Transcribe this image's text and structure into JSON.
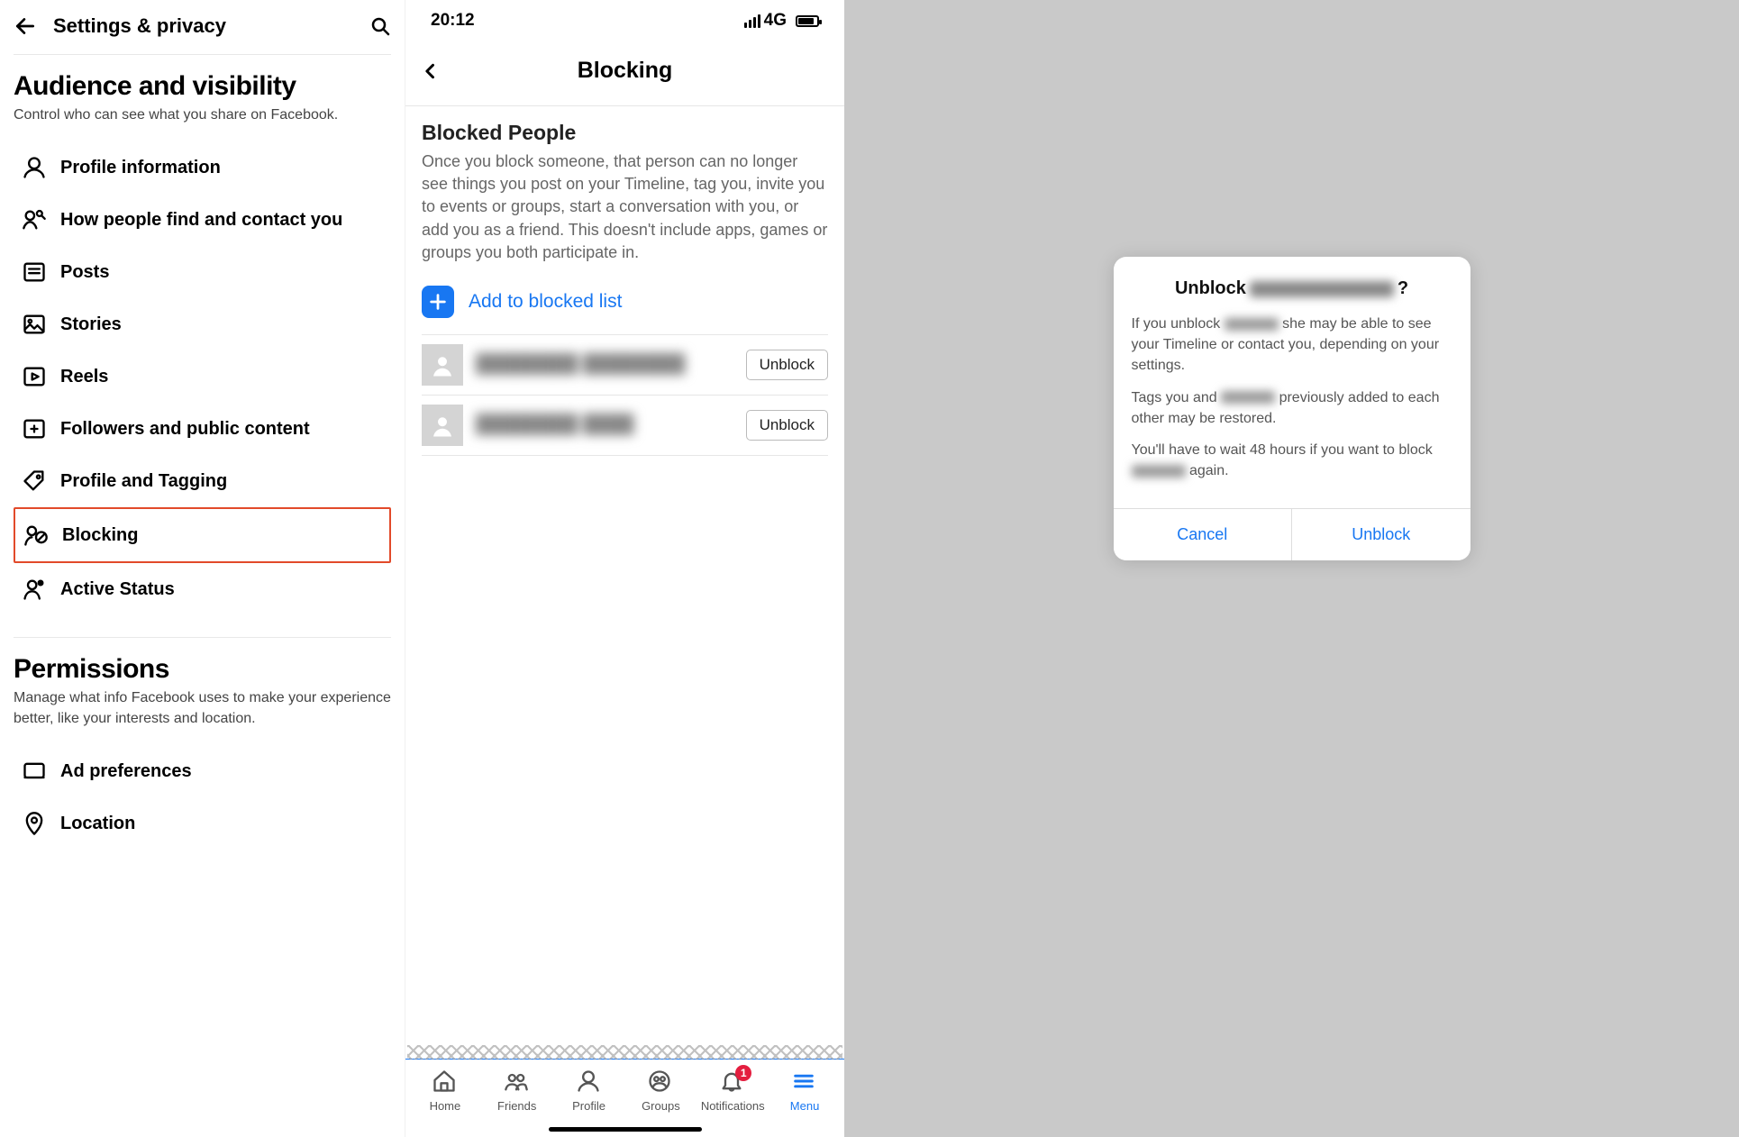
{
  "panel1": {
    "header_title": "Settings & privacy",
    "section1": {
      "title": "Audience and visibility",
      "subtitle": "Control who can see what you share on Facebook."
    },
    "items": [
      {
        "label": "Profile information",
        "icon": "profile"
      },
      {
        "label": "How people find and contact you",
        "icon": "find"
      },
      {
        "label": "Posts",
        "icon": "posts"
      },
      {
        "label": "Stories",
        "icon": "stories"
      },
      {
        "label": "Reels",
        "icon": "reels"
      },
      {
        "label": "Followers and public content",
        "icon": "followers"
      },
      {
        "label": "Profile and Tagging",
        "icon": "tag"
      },
      {
        "label": "Blocking",
        "icon": "blocking",
        "highlighted": true
      },
      {
        "label": "Active Status",
        "icon": "active"
      }
    ],
    "section2": {
      "title": "Permissions",
      "subtitle": "Manage what info Facebook uses to make your experience better, like your interests and location."
    },
    "items2": [
      {
        "label": "Ad preferences",
        "icon": "ads"
      },
      {
        "label": "Location",
        "icon": "location"
      }
    ]
  },
  "panel2": {
    "status_time": "20:12",
    "status_net": "4G",
    "header_title": "Blocking",
    "blocked_title": "Blocked People",
    "blocked_desc": "Once you block someone, that person can no longer see things you post on your Timeline, tag you, invite you to events or groups, start a conversation with you, or add you as a friend. This doesn't include apps, games or groups you both participate in.",
    "add_label": "Add to blocked list",
    "unblock_label": "Unblock",
    "people": [
      {
        "name": "████████ ████████"
      },
      {
        "name": "████████ ████"
      }
    ],
    "tabs": [
      {
        "label": "Home",
        "icon": "home"
      },
      {
        "label": "Friends",
        "icon": "friends"
      },
      {
        "label": "Profile",
        "icon": "profile"
      },
      {
        "label": "Groups",
        "icon": "groups"
      },
      {
        "label": "Notifications",
        "icon": "bell",
        "badge": "1"
      },
      {
        "label": "Menu",
        "icon": "menu",
        "active": true
      }
    ]
  },
  "panel3": {
    "title_prefix": "Unblock",
    "title_suffix": "?",
    "p1_a": "If you unblock ",
    "p1_b": " she may be able to see your Timeline or contact you, depending on your settings.",
    "p2_a": "Tags you and ",
    "p2_b": " previously added to each other may be restored.",
    "p3_a": "You'll have to wait 48 hours if you want to block ",
    "p3_b": " again.",
    "cancel": "Cancel",
    "unblock": "Unblock"
  }
}
